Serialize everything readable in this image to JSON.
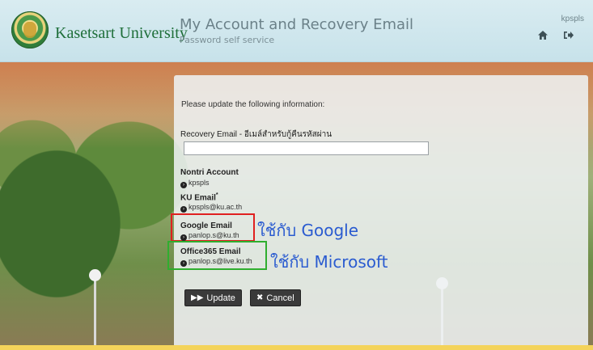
{
  "header": {
    "university": "Kasetsart University",
    "title": "My Account and Recovery Email",
    "subtitle": "Password self service",
    "username": "kpspls",
    "icons": {
      "home": "home-icon",
      "logout": "sign-out-icon"
    }
  },
  "form": {
    "intro": "Please update the following information:",
    "recovery_label": "Recovery Email - อีเมล์สำหรับกู้คืนรหัสผ่าน",
    "recovery_value": "",
    "nontri_label": "Nontri Account",
    "nontri_value": "kpspls",
    "ku_label": "KU Email",
    "ku_required": "*",
    "ku_value": "kpspls@ku.ac.th",
    "google_label": "Google Email",
    "google_value": "panlop.s@ku.th",
    "office_label": "Office365 Email",
    "office_value": "panlop.s@live.ku.th",
    "update_label": "Update",
    "cancel_label": "Cancel"
  },
  "annotations": {
    "google": "ใช้กับ Google",
    "microsoft": "ใช้กับ Microsoft",
    "google_color": "#e02020",
    "microsoft_color": "#2fae2f"
  }
}
